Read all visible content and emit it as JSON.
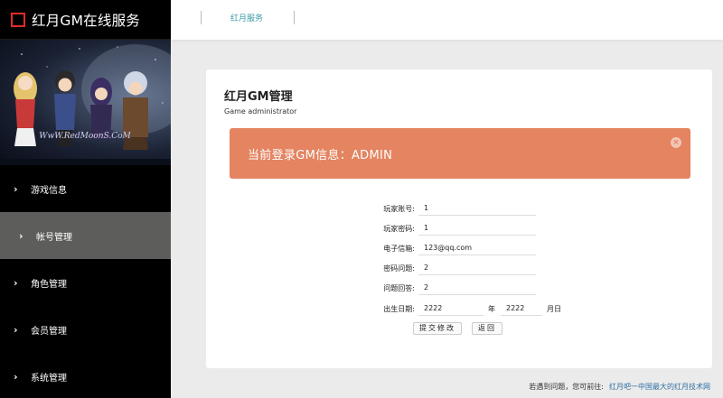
{
  "brand": {
    "title": "红月GM在线服务",
    "logo_color": "#e02b2b"
  },
  "banner": {
    "caption": "WwW.RedMoonS.CoM"
  },
  "sidebar": {
    "items": [
      {
        "label": "游戏信息"
      },
      {
        "label": "帐号管理"
      },
      {
        "label": "角色管理"
      },
      {
        "label": "会员管理"
      },
      {
        "label": "系统管理"
      }
    ],
    "active_index": 1
  },
  "topbar": {
    "nav_label": "红月服务"
  },
  "card": {
    "title": "红月GM管理",
    "subtitle": "Game administrator",
    "alert": {
      "text": "当前登录GM信息：ADMIN",
      "close": "×",
      "color": "#e48461"
    }
  },
  "form": {
    "account": {
      "label": "玩家账号:",
      "value": "1"
    },
    "password": {
      "label": "玩家密码:",
      "value": "1"
    },
    "email": {
      "label": "电子信箱:",
      "value": "123@qq.com"
    },
    "question": {
      "label": "密码问题:",
      "value": "2"
    },
    "answer": {
      "label": "问题回答:",
      "value": "2"
    },
    "birth": {
      "label": "出生日期:",
      "year_value": "2222",
      "year_unit": "年",
      "month_day_value": "2222",
      "month_day_unit": "月日"
    }
  },
  "buttons": {
    "submit": "提交修改",
    "back": "返回"
  },
  "footer": {
    "text": "若遇到问题，您可前往:",
    "link": "红月吧一中国最大的红月技术网"
  },
  "colors": {
    "accent_teal": "#3c9aa6",
    "active_menu": "#5d5e5b",
    "sidebar_bg": "#000000"
  }
}
